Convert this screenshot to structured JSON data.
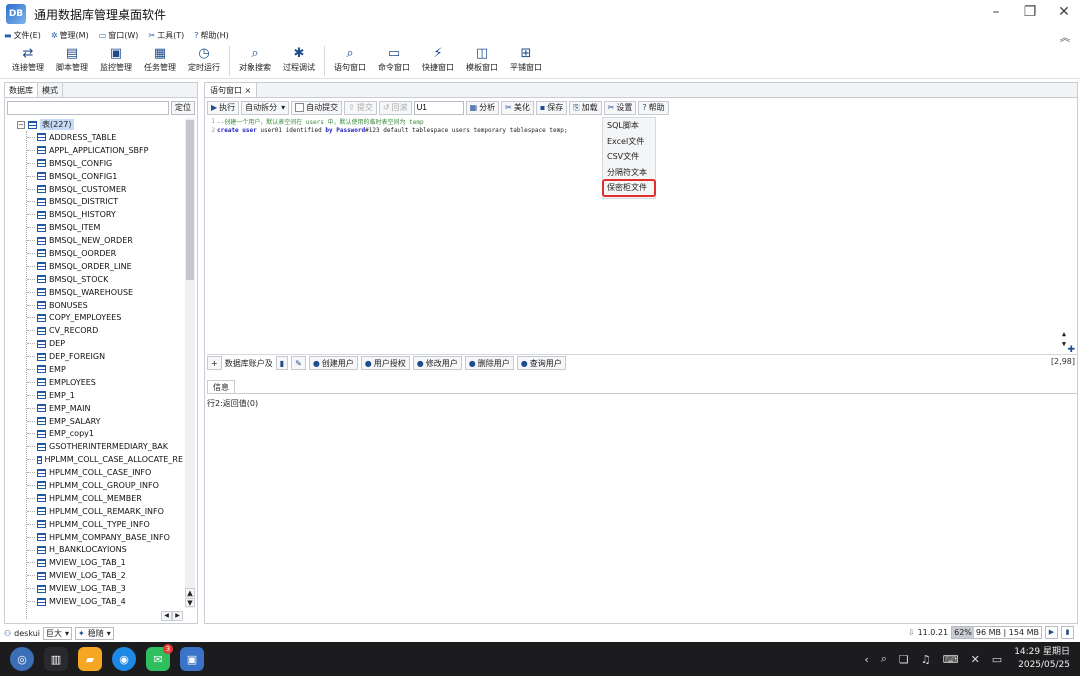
{
  "window": {
    "title": "通用数据库管理桌面软件",
    "logo_text": "DB"
  },
  "menu": [
    {
      "icon": "folder-icon",
      "glyph": "▬",
      "label": "文件(E)"
    },
    {
      "icon": "gear-icon",
      "glyph": "✲",
      "label": "管理(M)"
    },
    {
      "icon": "window-icon",
      "glyph": "▭",
      "label": "窗口(W)"
    },
    {
      "icon": "tools-icon",
      "glyph": "✂",
      "label": "工具(T)"
    },
    {
      "icon": "help-icon",
      "glyph": "?",
      "label": "帮助(H)"
    }
  ],
  "toolbar": [
    {
      "label": "连接管理",
      "glyph": "⇄",
      "icon": "connect-icon"
    },
    {
      "label": "脚本管理",
      "glyph": "▤",
      "icon": "script-icon"
    },
    {
      "label": "监控管理",
      "glyph": "▣",
      "icon": "monitor-icon"
    },
    {
      "label": "任务管理",
      "glyph": "▦",
      "icon": "task-icon"
    },
    {
      "label": "定时运行",
      "glyph": "◷",
      "icon": "clock-icon"
    },
    {
      "label": "对象搜索",
      "glyph": "⌕",
      "icon": "object-search-icon"
    },
    {
      "label": "过程调试",
      "glyph": "✱",
      "icon": "debug-icon"
    },
    {
      "label": "语句窗口",
      "glyph": "⌕",
      "icon": "statement-icon"
    },
    {
      "label": "命令窗口",
      "glyph": "▭",
      "icon": "command-icon"
    },
    {
      "label": "快捷窗口",
      "glyph": "⚡",
      "icon": "quick-icon"
    },
    {
      "label": "模板窗口",
      "glyph": "◫",
      "icon": "template-icon"
    },
    {
      "label": "平铺窗口",
      "glyph": "⊞",
      "icon": "tile-icon"
    }
  ],
  "left": {
    "tabs": [
      "数据库",
      "模式"
    ],
    "search_button": "定位",
    "root_label": "表(227)",
    "tables": [
      "ADDRESS_TABLE",
      "APPL_APPLICATION_SBFP",
      "BMSQL_CONFIG",
      "BMSQL_CONFIG1",
      "BMSQL_CUSTOMER",
      "BMSQL_DISTRICT",
      "BMSQL_HISTORY",
      "BMSQL_ITEM",
      "BMSQL_NEW_ORDER",
      "BMSQL_OORDER",
      "BMSQL_ORDER_LINE",
      "BMSQL_STOCK",
      "BMSQL_WAREHOUSE",
      "BONUSES",
      "COPY_EMPLOYEES",
      "CV_RECORD",
      "DEP",
      "DEP_FOREIGN",
      "EMP",
      "EMPLOYEES",
      "EMP_1",
      "EMP_MAIN",
      "EMP_SALARY",
      "EMP_copy1",
      "GSOTHERINTERMEDIARY_BAK",
      "HPLMM_COLL_CASE_ALLOCATE_RE",
      "HPLMM_COLL_CASE_INFO",
      "HPLMM_COLL_GROUP_INFO",
      "HPLMM_COLL_MEMBER",
      "HPLMM_COLL_REMARK_INFO",
      "HPLMM_COLL_TYPE_INFO",
      "HPLMM_COMPANY_BASE_INFO",
      "H_BANKLOCAYIONS",
      "MVIEW_LOG_TAB_1",
      "MVIEW_LOG_TAB_2",
      "MVIEW_LOG_TAB_3",
      "MVIEW_LOG_TAB_4"
    ]
  },
  "editor": {
    "tab": "语句窗口",
    "tab_close": "×",
    "toolbar": {
      "execute": "执行",
      "split": "自动拆分",
      "autocommit": "自动提交",
      "commit": "提交",
      "rollback": "回滚",
      "user_value": "U1",
      "analyze": "分析",
      "beautify": "美化",
      "save": "保存",
      "load": "加载",
      "settings": "设置",
      "help": "帮助"
    },
    "lines": [
      {
        "num": "1",
        "comment": "--创建一个用户，默认表空间在 users 中，默认使用的临时表空间为 temp"
      },
      {
        "num": "2",
        "kw1": "create user",
        "t1": " user01 identified ",
        "kw2": "by Password",
        "t2": "#123 default tablespace users temporary tablespace temp;"
      }
    ],
    "load_menu": [
      "SQL脚本",
      "Excel文件",
      "CSV文件",
      "分隔符文本",
      "保密柜文件"
    ],
    "load_menu_selected": "保密柜文件",
    "user_toolbar": {
      "add": "+",
      "account": "数据库账户及",
      "create": "创建用户",
      "grant": "用户授权",
      "modify": "修改用户",
      "delete": "删除用户",
      "query": "查询用户"
    },
    "cursor_pos": "[2,98]"
  },
  "info": {
    "tab": "信息",
    "message": "行2:返回值(0)"
  },
  "status": {
    "user": "deskui",
    "size": "巨大",
    "mode": "稳随",
    "version": "11.0.21",
    "percent": "62%",
    "memory": "96 MB",
    "memory_total": "154 MB"
  },
  "taskbar": {
    "time": "14:29 星期日",
    "date": "2025/05/25",
    "badge": "3"
  }
}
